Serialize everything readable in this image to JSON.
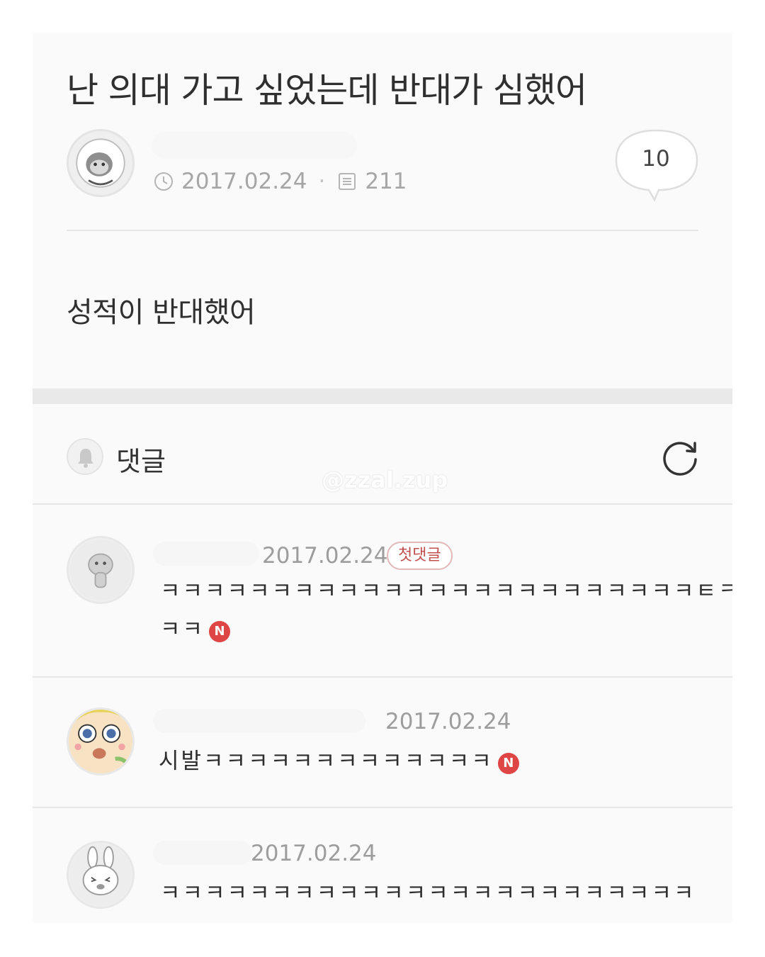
{
  "post": {
    "title": "난 의대 가고 싶었는데 반대가 심했어",
    "date": "2017.02.24",
    "meta_separator": "·",
    "views": "211",
    "comment_count": "10",
    "body": "성적이 반대했어"
  },
  "comments_section": {
    "label": "댓글",
    "watermark": "@zzal.zup"
  },
  "comments": [
    {
      "date": "2017.02.24",
      "badge": "첫댓글",
      "line1": "ㅋㅋㅋㅋㅋㅋㅋㅋㅋㅋㅋㅋㅋㅋㅋㅋㅋㅋㅋㅋㅋㅋㅋㅋㅌㅋ",
      "line2": "ㅋㅋ",
      "new_badge": "N"
    },
    {
      "date": "2017.02.24",
      "line1": "시발ㅋㅋㅋㅋㅋㅋㅋㅋㅋㅋㅋㅋㅋ",
      "new_badge": "N"
    },
    {
      "date": "2017.02.24",
      "line1": "ㅋㅋㅋㅋㅋㅋㅋㅋㅋㅋㅋㅋㅋㅋㅋㅋㅋㅋㅋㅋㅋㅋㅋㅋ"
    }
  ],
  "colors": {
    "new_badge": "#de4646",
    "first_badge_text": "#c0504d",
    "meta_gray": "#a6a6a6"
  },
  "icons": [
    "clock-icon",
    "document-icon",
    "speech-bubble-icon",
    "bell-icon",
    "refresh-icon"
  ]
}
